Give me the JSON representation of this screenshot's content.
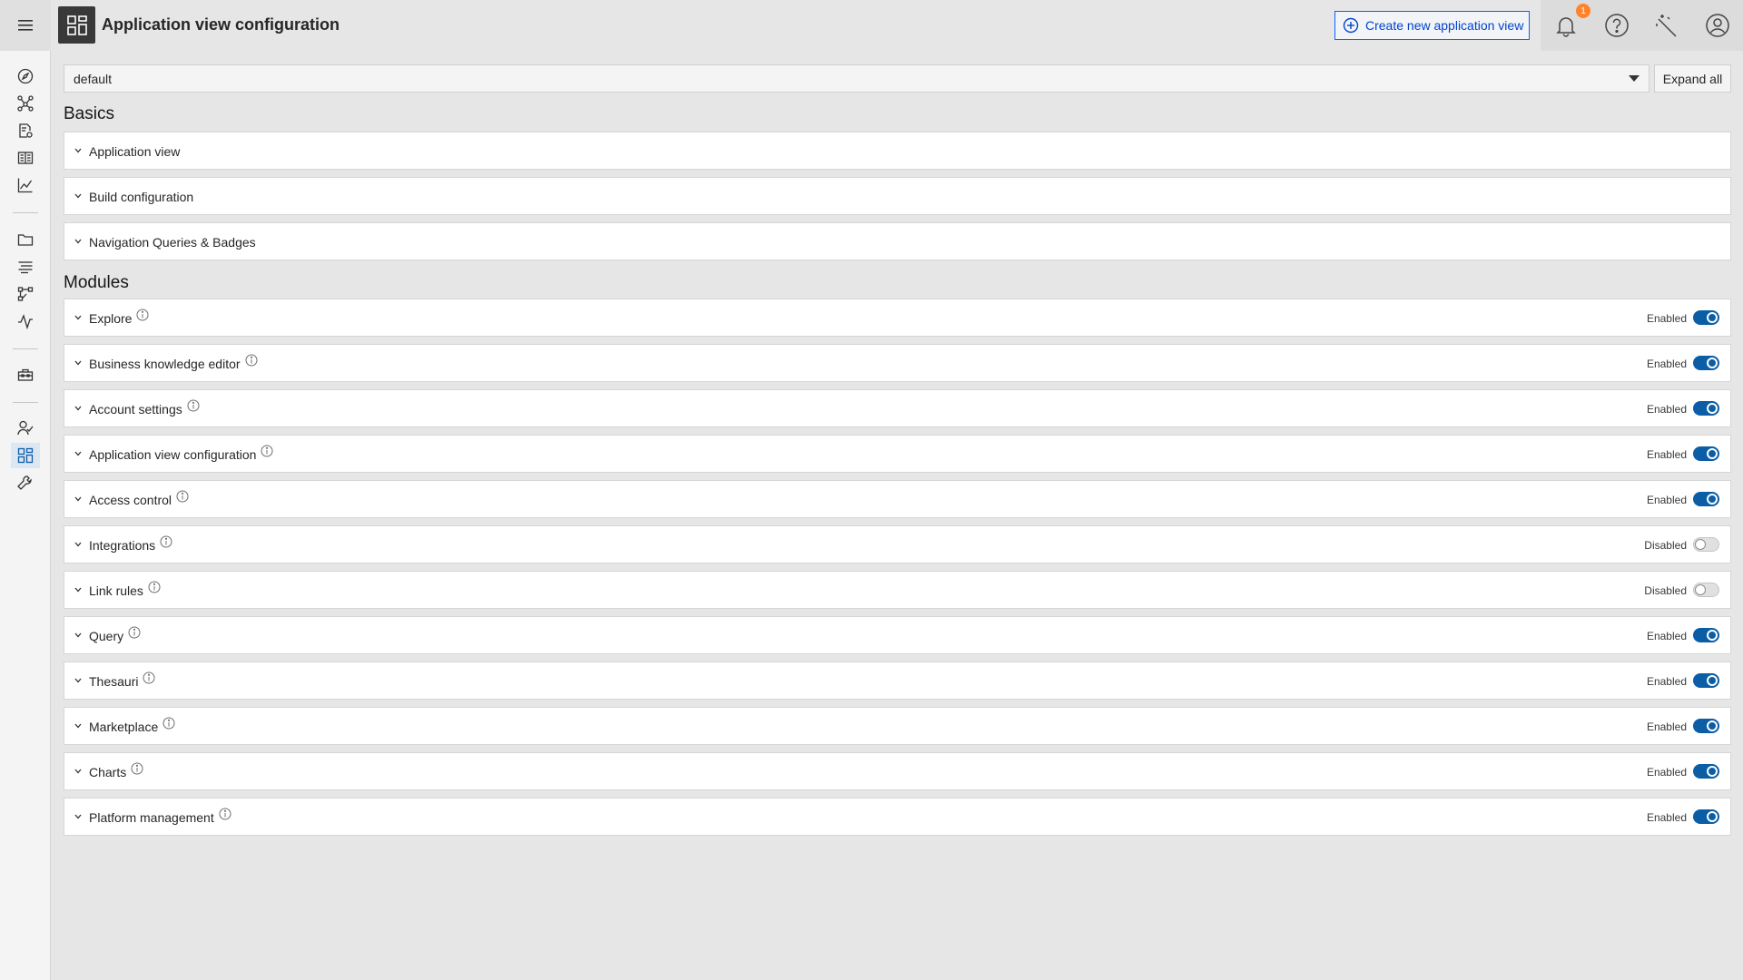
{
  "header": {
    "title": "Application view configuration",
    "create_button": "Create new application view",
    "notification_count": "1"
  },
  "sidenav": {
    "items": [
      {
        "icon": "compass-icon"
      },
      {
        "icon": "graph-icon"
      },
      {
        "icon": "document-settings-icon"
      },
      {
        "icon": "catalog-icon"
      },
      {
        "icon": "line-chart-icon"
      },
      {
        "icon": "folder-icon"
      },
      {
        "icon": "list-icon"
      },
      {
        "icon": "flow-icon"
      },
      {
        "icon": "activity-icon"
      },
      {
        "icon": "toolbox-icon"
      },
      {
        "icon": "user-access-icon"
      },
      {
        "icon": "dashboard-icon",
        "active": true
      },
      {
        "icon": "wrench-icon"
      }
    ]
  },
  "toolbar": {
    "dropdown_value": "default",
    "expand_all": "Expand all"
  },
  "basics": {
    "title": "Basics",
    "items": [
      "Application view",
      "Build configuration",
      "Navigation Queries & Badges"
    ]
  },
  "modules": {
    "title": "Modules",
    "items": [
      {
        "label": "Explore",
        "status": "Enabled",
        "enabled": true
      },
      {
        "label": "Business knowledge editor",
        "status": "Enabled",
        "enabled": true
      },
      {
        "label": "Account settings",
        "status": "Enabled",
        "enabled": true
      },
      {
        "label": "Application view configuration",
        "status": "Enabled",
        "enabled": true
      },
      {
        "label": "Access control",
        "status": "Enabled",
        "enabled": true
      },
      {
        "label": "Integrations",
        "status": "Disabled",
        "enabled": false
      },
      {
        "label": "Link rules",
        "status": "Disabled",
        "enabled": false
      },
      {
        "label": "Query",
        "status": "Enabled",
        "enabled": true
      },
      {
        "label": "Thesauri",
        "status": "Enabled",
        "enabled": true
      },
      {
        "label": "Marketplace",
        "status": "Enabled",
        "enabled": true
      },
      {
        "label": "Charts",
        "status": "Enabled",
        "enabled": true
      },
      {
        "label": "Platform management",
        "status": "Enabled",
        "enabled": true
      }
    ]
  },
  "colors": {
    "accent": "#0b5ea5",
    "link": "#0043ce",
    "badge": "#ff832b"
  }
}
